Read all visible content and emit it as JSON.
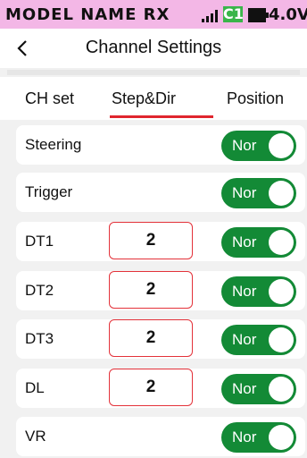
{
  "status": {
    "model_name": "MODEL NAME RX",
    "channel_badge": "C1",
    "voltage": "4.0V",
    "icons": [
      "signal-icon",
      "battery-icon"
    ],
    "colors": {
      "bar": "#f3b7e6",
      "badge": "#3ab54a"
    }
  },
  "header": {
    "title": "Channel Settings",
    "back_icon": "chevron-left-icon"
  },
  "tabs": [
    {
      "label": "CH set",
      "selected": false
    },
    {
      "label": "Step&Dir",
      "selected": true
    },
    {
      "label": "Position",
      "selected": false
    }
  ],
  "rows": [
    {
      "label": "Steering",
      "toggle": "Nor"
    },
    {
      "label": "Trigger",
      "toggle": "Nor"
    },
    {
      "label": "DT1",
      "value": "2",
      "toggle": "Nor"
    },
    {
      "label": "DT2",
      "value": "2",
      "toggle": "Nor"
    },
    {
      "label": "DT3",
      "value": "2",
      "toggle": "Nor"
    },
    {
      "label": "DL",
      "value": "2",
      "toggle": "Nor"
    },
    {
      "label": "VR",
      "toggle": "Nor"
    }
  ],
  "colors": {
    "accent": "#e0262e",
    "toggle_on": "#138a36"
  }
}
